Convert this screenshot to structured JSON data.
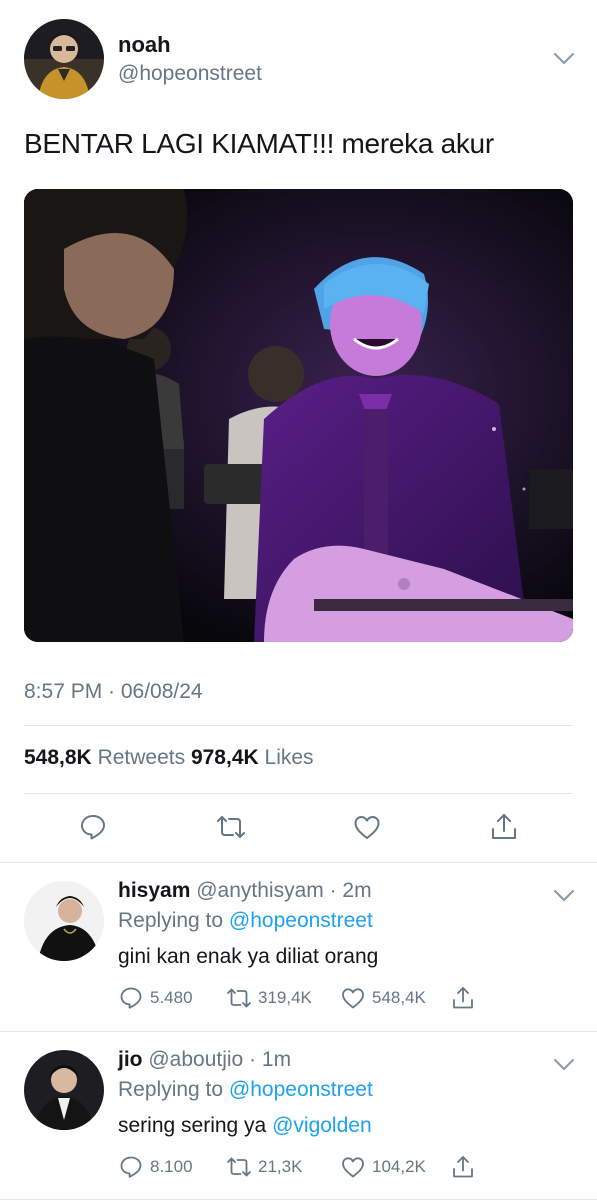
{
  "tweet": {
    "display_name": "noah",
    "handle": "@hopeonstreet",
    "text": "BENTAR LAGI KIAMAT!!! mereka akur",
    "timestamp": "8:57 PM · 06/08/24",
    "retweets_count": "548,8K",
    "retweets_label": "Retweets",
    "likes_count": "978,4K",
    "likes_label": "Likes",
    "media_icon": "photo-media"
  },
  "actions": {
    "reply_icon": "reply-icon",
    "retweet_icon": "retweet-icon",
    "like_icon": "heart-icon",
    "share_icon": "share-icon"
  },
  "replies": [
    {
      "display_name": "hisyam",
      "meta": "@anythisyam · 2m",
      "replying_prefix": "Replying to",
      "replying_to": "@hopeonstreet",
      "text_before_mention": "gini kan enak ya diliat orang",
      "mention": "",
      "reply_count": "5.480",
      "retweet_count": "319,4K",
      "like_count": "548,4K"
    },
    {
      "display_name": "jio",
      "meta": "@aboutjio · 1m",
      "replying_prefix": "Replying to",
      "replying_to": "@hopeonstreet",
      "text_before_mention": "sering sering ya",
      "mention": "@vigolden",
      "reply_count": "8.100",
      "retweet_count": "21,3K",
      "like_count": "104,2K"
    }
  ],
  "colors": {
    "link": "#1da1f2",
    "secondary_text": "#657786",
    "primary_text": "#14171a",
    "divider": "#e1e8ed"
  }
}
